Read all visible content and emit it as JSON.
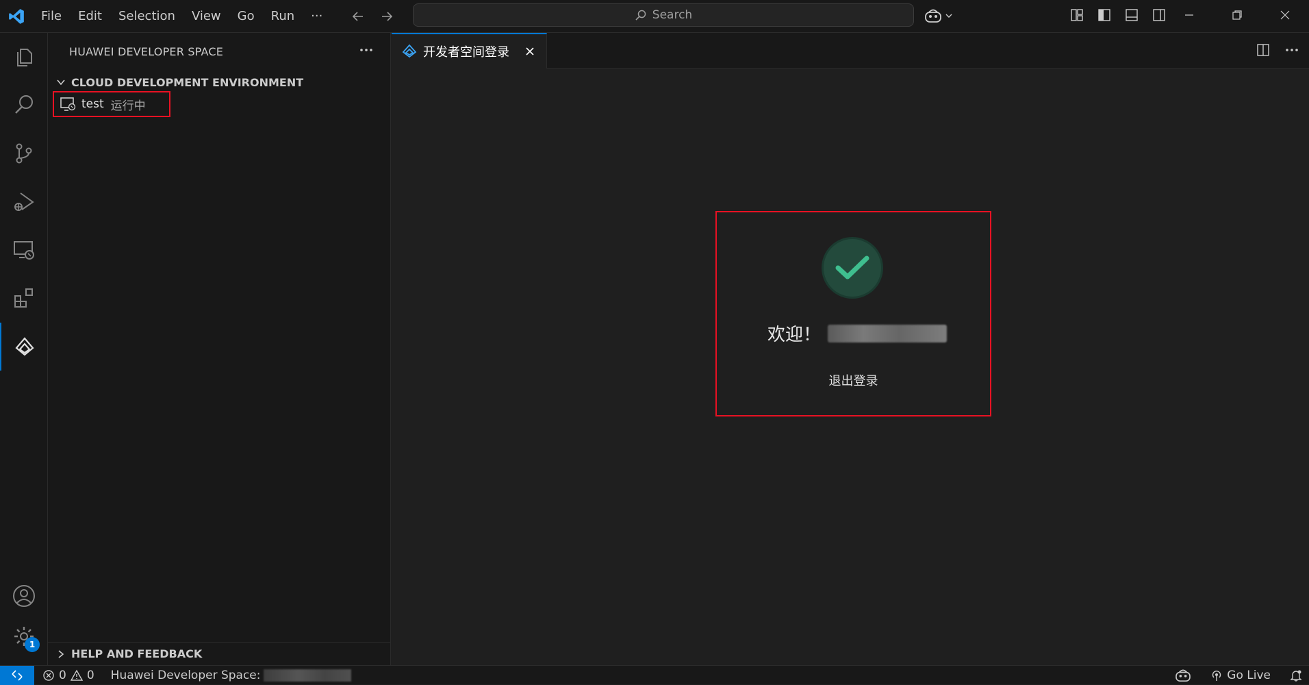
{
  "titlebar": {
    "menu": [
      "File",
      "Edit",
      "Selection",
      "View",
      "Go",
      "Run",
      "···"
    ],
    "search_label": "Search"
  },
  "sidebar": {
    "title": "HUAWEI DEVELOPER SPACE",
    "section_title": "CLOUD DEVELOPMENT ENVIRONMENT",
    "item": {
      "name": "test",
      "status": "运行中"
    },
    "help_title": "HELP AND FEEDBACK"
  },
  "activitybar": {
    "settings_badge": "1"
  },
  "editor": {
    "tab_title": "开发者空间登录",
    "welcome_text": "欢迎！",
    "logout_label": "退出登录"
  },
  "statusbar": {
    "errors": "0",
    "warnings": "0",
    "developer_space_label": "Huawei Developer Space:",
    "go_live": "Go Live"
  },
  "colors": {
    "accent": "#0078d4",
    "highlight_border": "#e81123",
    "success": "#3fbf8f"
  }
}
